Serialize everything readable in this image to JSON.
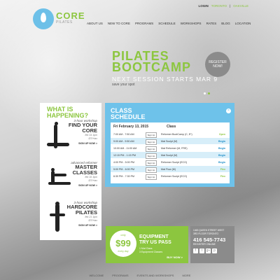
{
  "brand": {
    "name": "CORE",
    "tagline": "PILATES"
  },
  "topnav": {
    "login": "LOGIN",
    "city1": "TORONTO",
    "sep": "|",
    "city2": "OAKVILLE"
  },
  "nav": [
    "ABOUT US",
    "NEW TO CORE",
    "PROGRAMS",
    "SCHEDULE",
    "WORKSHOPS",
    "RATES",
    "BLOG",
    "LOCATION"
  ],
  "hero": {
    "title_line1": "PILATES",
    "title_line2": "BOOTCAMP",
    "subtitle": "NEXT SESSION STARTS MAR 9",
    "save": "save your spot",
    "register": [
      "REGISTER",
      "NOW!"
    ]
  },
  "happening": {
    "line1": "WHAT IS",
    "line2": "HAPPENING?"
  },
  "promos": [
    {
      "kicker": "3-hour workshop",
      "title1": "FIND YOUR",
      "title2": "CORE",
      "date": "feb 14 1pm",
      "price": "$70+tax",
      "signup": "SIGN UP NOW >"
    },
    {
      "kicker": "advanced reformer",
      "title1": "MASTER",
      "title2": "CLASSES",
      "date": "feb 16 3pm",
      "price": "$70+tax",
      "signup": "SIGN UP NOW >"
    },
    {
      "kicker": "3-hour workshop",
      "title1": "HARDCORE",
      "title2": "PILATES",
      "date": "feb 21 1pm",
      "price": "$70+tax",
      "signup": "SIGN UP NOW >"
    }
  ],
  "schedule": {
    "title1": "CLASS",
    "title2": "SCHEDULE",
    "close": "×",
    "date": "Fri  February 13, 2015",
    "class_header": "Class",
    "rows": [
      {
        "time": "7:00 AM - 7:50 AM",
        "signup": "Sign Up",
        "class": "Reformer BootCamp (C, E*)",
        "level": "Open"
      },
      {
        "time": "9:00 AM - 9:50 AM",
        "signup": "Sign Up",
        "class": "Mat Sculpt (M)",
        "level": "Begin"
      },
      {
        "time": "10:00 AM - 11:00 AM",
        "signup": "Sign Up",
        "class": "Mat Reformer (M, FRE)",
        "level": "Begin"
      },
      {
        "time": "12:15 PM - 1:15 PM",
        "signup": "Sign Up",
        "class": "Mat Sculpt (M)",
        "level": "Begin"
      },
      {
        "time": "4:00 PM - 5:00 PM",
        "signup": "Sign Up",
        "class": "Reformer Sculpt (ECO)",
        "level": "Begin"
      },
      {
        "time": "5:00 PM - 6:00 PM",
        "signup": "Sign Up",
        "class": "Mat Flow (M)",
        "level": "Flex"
      },
      {
        "time": "6:30 PM - 7:30 PM",
        "signup": "Sign Up",
        "class": "Reformer Sculpt (ECO)",
        "level": "Flex"
      }
    ]
  },
  "equipment": {
    "only": "only",
    "price": "$99",
    "every": "every day",
    "title1": "EQUIPMENT",
    "title2": "TRY US PASS",
    "line1": "1 Mat Class",
    "line2": "3 Equipment Classes",
    "buy": "BUY NOW >"
  },
  "contact": {
    "addr1": "1463 QUEEN STREET WEST",
    "addr2": "3RD FLOOR TORONTO",
    "phone": "416 545-7743",
    "register": "REGISTER ONLINE",
    "icons": [
      "f",
      "t",
      "g+",
      "p"
    ]
  },
  "footer": [
    "WELCOME",
    "PROGRAMS",
    "EVENTS AND WORKSHOPS",
    "MORE"
  ]
}
